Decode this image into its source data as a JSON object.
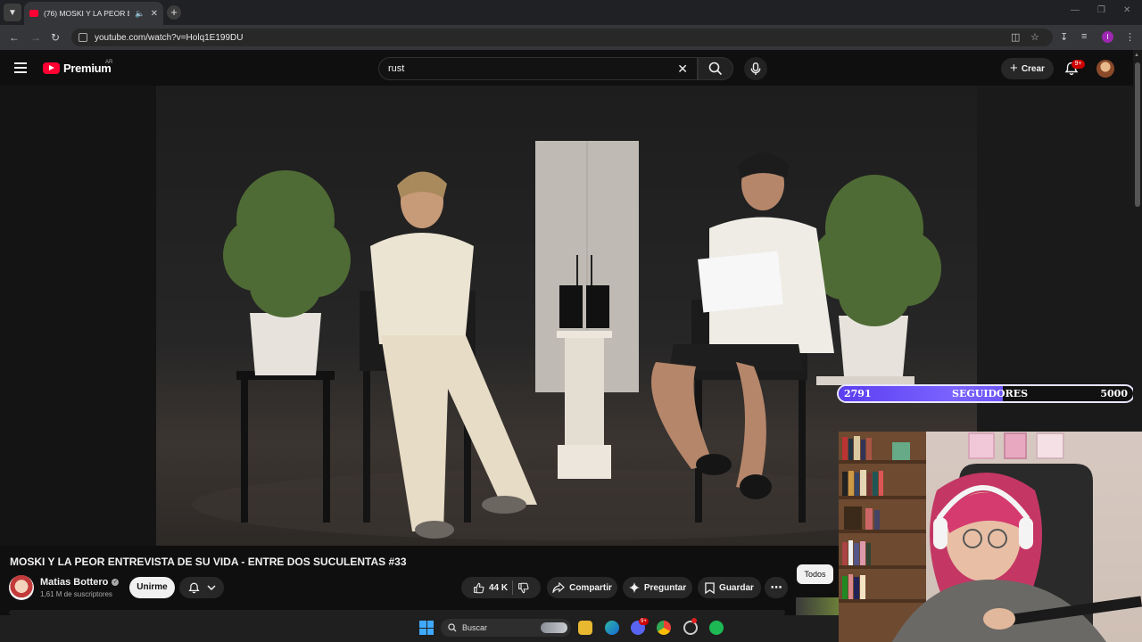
{
  "browser": {
    "tab_title": "(76) MOSKI Y LA PEOR ENT",
    "url": "youtube.com/watch?v=Holq1E199DU",
    "profile_initial": "I"
  },
  "header": {
    "brand": "Premium",
    "region": "AR",
    "search_value": "rust",
    "create_label": "Crear",
    "notifications_badge": "9+"
  },
  "video": {
    "title": "MOSKI Y LA PEOR ENTREVISTA DE SU VIDA - ENTRE DOS SUCULENTAS #33",
    "channel_name": "Matias Bottero",
    "subscribers": "1,61 M de suscriptores",
    "join_label": "Unirme",
    "likes": "44 K",
    "share_label": "Compartir",
    "ask_label": "Preguntar",
    "save_label": "Guardar"
  },
  "sidebar": {
    "filter_all": "Todos"
  },
  "overlay": {
    "followers_current": "2791",
    "followers_label": "SEGUIDORES",
    "followers_goal": "5000",
    "progress_fraction": 0.5582
  },
  "taskbar": {
    "search_label": "Buscar",
    "discord_badge": "9+"
  },
  "colors": {
    "yt_red": "#ff0033",
    "goal_purple": "#6c55f7",
    "background": "#0f0f0f"
  }
}
